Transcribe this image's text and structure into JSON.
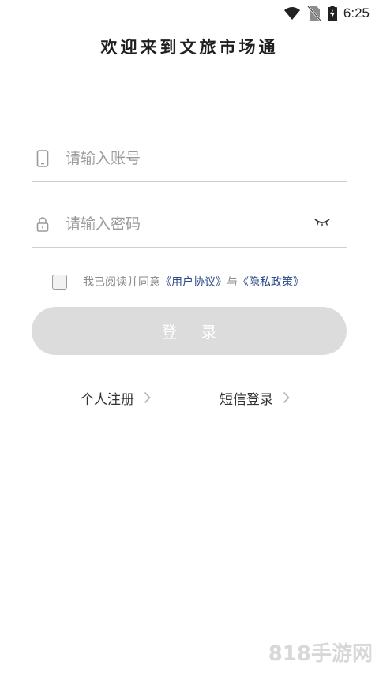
{
  "status_bar": {
    "time": "6:25",
    "icons": [
      "wifi-icon",
      "no-sim-icon",
      "battery-charging-icon"
    ]
  },
  "title": "欢迎来到文旅市场通",
  "account_field": {
    "icon": "phone-icon",
    "placeholder": "请输入账号",
    "value": ""
  },
  "password_field": {
    "icon": "lock-icon",
    "placeholder": "请输入密码",
    "value": "",
    "toggle_icon": "eye-closed-icon"
  },
  "agreement": {
    "checked": false,
    "prefix": "我已阅读并同意",
    "user_agreement": "《用户协议》",
    "conjunction": "与",
    "privacy_policy": "《隐私政策》"
  },
  "login_button": "登录",
  "links": {
    "register": "个人注册",
    "sms_login": "短信登录",
    "chevron_icon": "chevron-right-icon"
  },
  "watermark": "818手游网",
  "colors": {
    "button_disabled": "#dcdcdc",
    "link": "#2b4a8a",
    "placeholder": "#9a9a9a",
    "divider": "#cfcfcf"
  }
}
